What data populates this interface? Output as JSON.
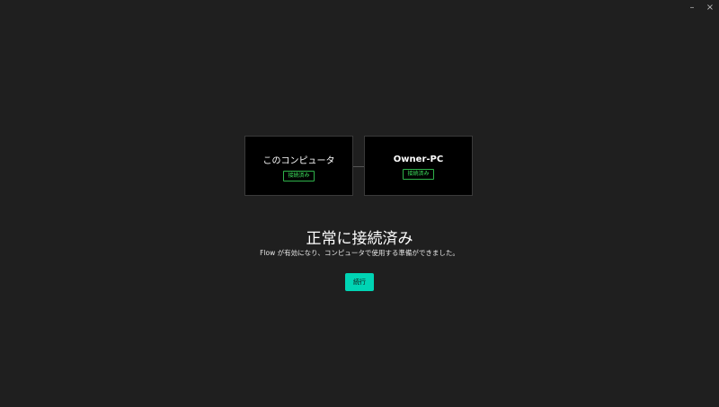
{
  "window": {
    "minimize_label": "–",
    "close_label": "×"
  },
  "computers": {
    "this_computer": {
      "name": "このコンピュータ",
      "status": "接続済み"
    },
    "remote_computer": {
      "name": "Owner-PC",
      "status": "接続済み"
    }
  },
  "message": {
    "headline": "正常に接続済み",
    "description": "Flow が有効になり、コンピュータで使用する準備ができました。"
  },
  "actions": {
    "continue_label": "続行"
  },
  "colors": {
    "background": "#1f1f1f",
    "card_background": "#000000",
    "status_green": "#3ee35e",
    "accent": "#00d4b4"
  }
}
